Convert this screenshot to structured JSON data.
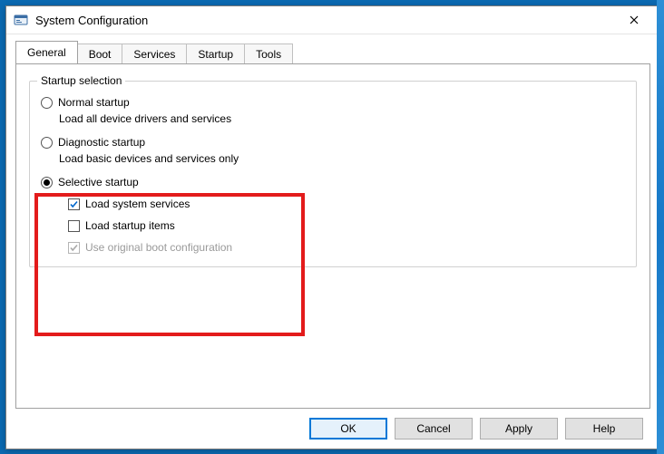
{
  "window": {
    "title": "System Configuration"
  },
  "tabs": {
    "general": "General",
    "boot": "Boot",
    "services": "Services",
    "startup": "Startup",
    "tools": "Tools"
  },
  "group": {
    "legend": "Startup selection",
    "normal": {
      "label": "Normal startup",
      "desc": "Load all device drivers and services"
    },
    "diagnostic": {
      "label": "Diagnostic startup",
      "desc": "Load basic devices and services only"
    },
    "selective": {
      "label": "Selective startup",
      "load_system_services": "Load system services",
      "load_startup_items": "Load startup items",
      "use_original_boot": "Use original boot configuration"
    }
  },
  "buttons": {
    "ok": "OK",
    "cancel": "Cancel",
    "apply": "Apply",
    "help": "Help"
  }
}
